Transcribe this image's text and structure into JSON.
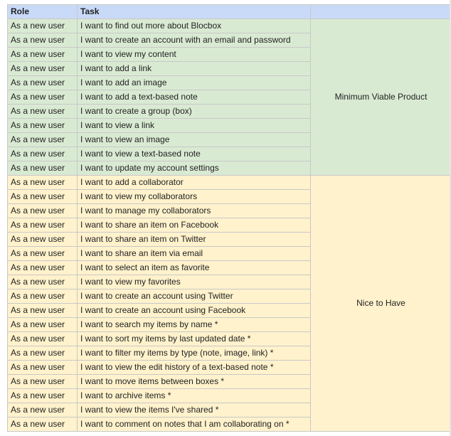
{
  "headers": {
    "role": "Role",
    "task": "Task",
    "phase": ""
  },
  "phases": {
    "mvp": "Minimum Viable Product",
    "nice": "Nice to Have"
  },
  "rows": [
    {
      "role": "As a new user",
      "task": "I want to find out more about Blocbox",
      "phase": "mvp"
    },
    {
      "role": "As a new user",
      "task": "I want to create an account with an email and password",
      "phase": "mvp"
    },
    {
      "role": "As a new user",
      "task": "I want to view my content",
      "phase": "mvp"
    },
    {
      "role": "As a new user",
      "task": "I want to add a link",
      "phase": "mvp"
    },
    {
      "role": "As a new user",
      "task": "I want to add an image",
      "phase": "mvp"
    },
    {
      "role": "As a new user",
      "task": "I want to add a text-based note",
      "phase": "mvp"
    },
    {
      "role": "As a new user",
      "task": "I want to create a group (box)",
      "phase": "mvp"
    },
    {
      "role": "As a new user",
      "task": "I want to view a link",
      "phase": "mvp"
    },
    {
      "role": "As a new user",
      "task": "I want to view an image",
      "phase": "mvp"
    },
    {
      "role": "As a new user",
      "task": "I want to view a text-based note",
      "phase": "mvp"
    },
    {
      "role": "As a new user",
      "task": "I want to update my account settings",
      "phase": "mvp"
    },
    {
      "role": "As a new user",
      "task": "I want to add a collaborator",
      "phase": "nice"
    },
    {
      "role": "As a new user",
      "task": "I want to view my collaborators",
      "phase": "nice"
    },
    {
      "role": "As a new user",
      "task": "I want to manage my collaborators",
      "phase": "nice"
    },
    {
      "role": "As a new user",
      "task": "I want to share an item on Facebook",
      "phase": "nice"
    },
    {
      "role": "As a new user",
      "task": "I want to share an item on Twitter",
      "phase": "nice"
    },
    {
      "role": "As a new user",
      "task": "I want to share an item via email",
      "phase": "nice"
    },
    {
      "role": "As a new user",
      "task": "I want to select an item as favorite",
      "phase": "nice"
    },
    {
      "role": "As a new user",
      "task": "I want to view my favorites",
      "phase": "nice"
    },
    {
      "role": "As a new user",
      "task": "I want to create an account using Twitter",
      "phase": "nice"
    },
    {
      "role": "As a new user",
      "task": "I want to create an account using Facebook",
      "phase": "nice"
    },
    {
      "role": "As a new user",
      "task": "I want to search my items by name *",
      "phase": "nice"
    },
    {
      "role": "As a new user",
      "task": "I want to sort my items by last updated date *",
      "phase": "nice"
    },
    {
      "role": "As a new user",
      "task": "I want to filter my items by type (note, image, link) *",
      "phase": "nice"
    },
    {
      "role": "As a new user",
      "task": "I want to view the edit history of a text-based note *",
      "phase": "nice"
    },
    {
      "role": "As a new user",
      "task": "I want to move items between boxes *",
      "phase": "nice"
    },
    {
      "role": "As a new user",
      "task": "I want to archive items *",
      "phase": "nice"
    },
    {
      "role": "As a new user",
      "task": "I want to view the items I've shared *",
      "phase": "nice"
    },
    {
      "role": "As a new user",
      "task": "I want to comment on notes that I am collaborating on *",
      "phase": "nice"
    }
  ],
  "colors": {
    "header_bg": "#c9daf8",
    "mvp_bg": "#d9ead3",
    "nice_bg": "#fff2cc",
    "grid": "#c8c8c8"
  }
}
